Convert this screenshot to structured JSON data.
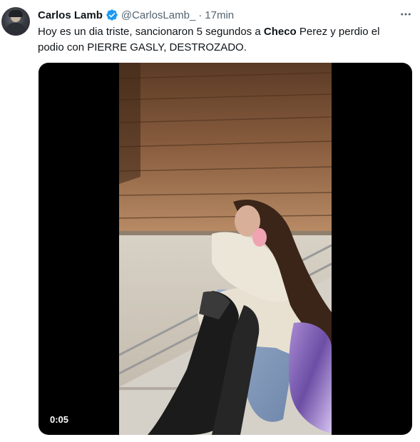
{
  "tweet": {
    "author": {
      "name": "Carlos Lamb",
      "handle": "@CarlosLamb_",
      "verified": true
    },
    "separator": "·",
    "time": "17min",
    "text_parts": [
      {
        "text": "Hoy es un dia triste, sancionaron 5 segundos a ",
        "bold": false
      },
      {
        "text": "Checo",
        "bold": true
      },
      {
        "text": " Perez y perdio el podio con PIERRE GASLY, DESTROZADO.",
        "bold": false
      }
    ],
    "media": {
      "kind": "video",
      "duration": "0:05"
    },
    "icons": {
      "verified": "verified-badge-icon",
      "more": "more-options-icon"
    },
    "colors": {
      "verified": "#1d9bf0",
      "text": "#0f1419",
      "secondary": "#536471"
    }
  }
}
